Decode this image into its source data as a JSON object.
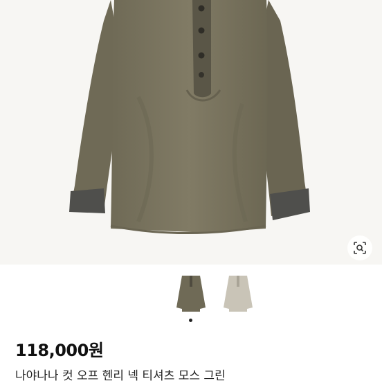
{
  "product": {
    "price": "118,000원",
    "title": "나야나나 컷 오프 헨리 넥 티셔츠 모스 그린"
  },
  "gallery": {
    "thumbnails": [
      "moss-green-henley-shirt",
      "light-grey-henley-shirt"
    ],
    "active_index": 0,
    "page_count": 1
  },
  "colors": {
    "shirt_main": "#7b755f",
    "shirt_shadow": "#5f5a48",
    "cuff": "#4f4f4c",
    "thumb2": "#c9c4b7"
  },
  "icons": {
    "lens": "search-lens-icon"
  }
}
